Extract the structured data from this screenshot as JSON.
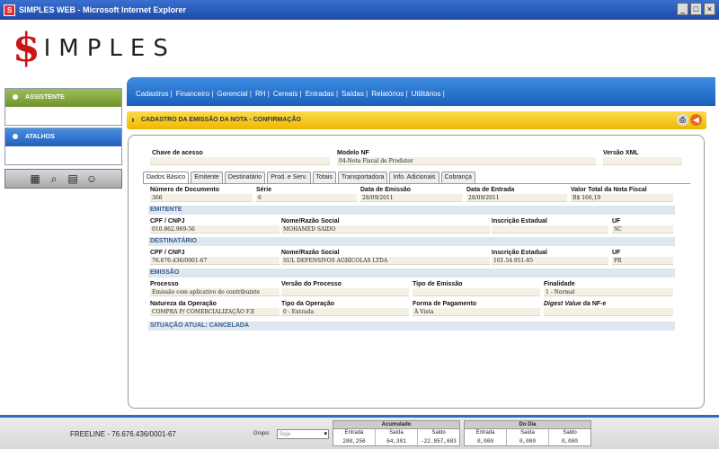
{
  "window": {
    "title": "SIMPLES WEB - Microsoft Internet Explorer"
  },
  "logo": {
    "dollar": "$",
    "rest": "IMPLES"
  },
  "sidebar": {
    "assistente": "ASSISTENTE",
    "atalhos": "ATALHOS",
    "shortcuts": [
      "calculator-icon",
      "search-icon",
      "calendar-icon",
      "user-icon"
    ]
  },
  "menu": [
    "Cadastros |",
    "Financeiro |",
    "Gerencial |",
    "RH |",
    "Cereais |",
    "Entradas |",
    "Saídas |",
    "Relatórios |",
    "Utilitários |"
  ],
  "page": {
    "title": "CADASTRO DA EMISSÃO DA NOTA - CONFIRMAÇÃO"
  },
  "form": {
    "chave_acesso_label": "Chave de acesso",
    "modelo_nf_label": "Modelo NF",
    "modelo_nf_value": "04-Nota Fiscal de Produtor",
    "versao_xml_label": "Versão XML",
    "tabs": [
      "Dados Básico",
      "Emitente",
      "Destinatário",
      "Prod. e Serv.",
      "Totais",
      "Transportadora",
      "Info. Adicionais",
      "Cobrança"
    ],
    "numero_label": "Número de Documento",
    "numero_value": "366",
    "serie_label": "Série",
    "serie_value": "6",
    "data_emissao_label": "Data de Emissão",
    "data_emissao_value": "28/09/2011",
    "data_entrada_label": "Data de Entrada",
    "data_entrada_value": "28/09/2011",
    "valor_total_label": "Valor Total da Nota Fiscal",
    "valor_total_value": "R$ 166,19",
    "emitente_section": "EMITENTE",
    "emit_cpf_label": "CPF / CNPJ",
    "emit_cpf_value": "010.862.969-56",
    "emit_nome_label": "Nome/Razão Social",
    "emit_nome_value": "MOHAMED SAIDO",
    "emit_ie_label": "Inscrição Estadual",
    "emit_ie_value": "",
    "emit_uf_label": "UF",
    "emit_uf_value": "SC",
    "dest_section": "DESTINATÁRIO",
    "dest_cpf_label": "CPF / CNPJ",
    "dest_cpf_value": "76.676.436/0001-67",
    "dest_nome_label": "Nome/Razão Social",
    "dest_nome_value": "SUL DEFENSIVOS AGRÍCOLAS LTDA",
    "dest_ie_label": "Inscrição Estadual",
    "dest_ie_value": "101.54.951-85",
    "dest_uf_label": "UF",
    "dest_uf_value": "PR",
    "emissao_section": "EMISSÃO",
    "processo_label": "Processo",
    "processo_value": "Emissão com aplicativo do contribuinte",
    "versao_processo_label": "Versão do Processo",
    "tipo_emissao_label": "Tipo de Emissão",
    "finalidade_label": "Finalidade",
    "finalidade_value": "1 - Normal",
    "natureza_label": "Natureza da Operação",
    "natureza_value": "COMPRA P/ COMERCIALIZAÇÃO F.E",
    "tipo_operacao_label": "Tipo da Operação",
    "tipo_operacao_value": "0 - Entrada",
    "forma_pagamento_label": "Forma de Pagamento",
    "forma_pagamento_value": "À Vista",
    "digest_label_italic": "Digest Value",
    "digest_label_rest": " da NF-e",
    "situacao": "SITUAÇÃO ATUAL: CANCELADA"
  },
  "footer": {
    "freeline": "FREELINE - 76.676.436/0001-67",
    "grupo_label": "Grupo:",
    "grupo_value": "Soja",
    "acumulado": {
      "title": "Acumulado",
      "headers": [
        "Entrada",
        "Saída",
        "Saldo"
      ],
      "values": [
        "288,256",
        "64,301",
        "-22.857,683"
      ]
    },
    "dodia": {
      "title": "Do Dia",
      "headers": [
        "Entrada",
        "Saída",
        "Saldo"
      ],
      "values": [
        "0,000",
        "0,000",
        "0,000"
      ]
    }
  },
  "colors": {
    "menu_blue": "#1b5fb8",
    "page_bar_yellow": "#f0b800",
    "assistente_green": "#6f922c",
    "section_blue": "#3a5f8e"
  }
}
